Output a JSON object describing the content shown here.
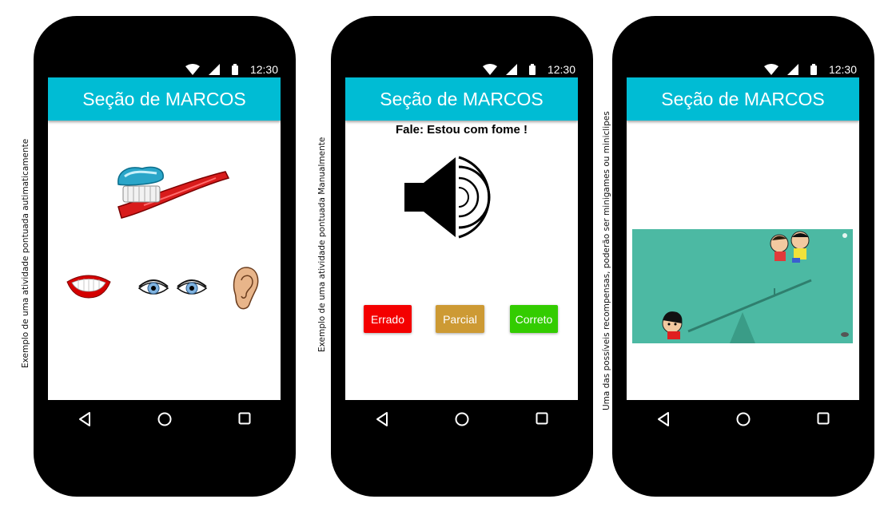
{
  "captions": {
    "left": "Exemplo de uma atividade pontuada autimaticamente",
    "middle": "Exemplo de uma atividade pontuada Manualmente",
    "right": "Uma das possíveis recompensas, poderão ser minigames ou miniclipes"
  },
  "status": {
    "time": "12:30"
  },
  "app": {
    "title": "Seção de MARCOS"
  },
  "phone2": {
    "prompt": "Fale: Estou com fome !",
    "buttons": {
      "wrong": "Errado",
      "partial": "Parcial",
      "correct": "Correto"
    }
  },
  "colors": {
    "appbar": "#00BCD4",
    "wrong": "#F40000",
    "partial": "#CD9A34",
    "correct": "#33CC00",
    "game_bg": "#4CB9A3"
  },
  "icons": [
    "toothbrush-icon",
    "mouth-icon",
    "eyes-icon",
    "ear-icon",
    "speaker-icon",
    "back-icon",
    "home-icon",
    "recents-icon"
  ]
}
